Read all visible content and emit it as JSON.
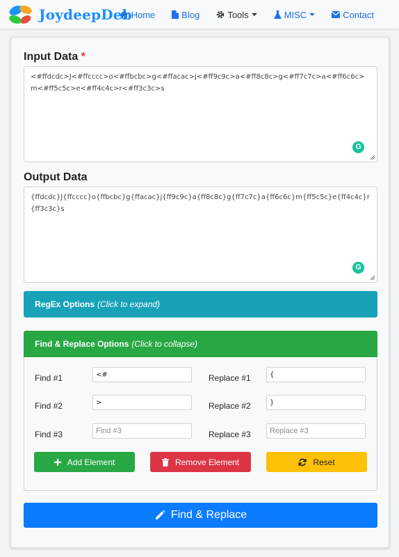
{
  "brand": {
    "name": "JoydeepDeb"
  },
  "nav": {
    "home": "Home",
    "blog": "Blog",
    "tools": "Tools",
    "misc": "MISC",
    "contact": "Contact"
  },
  "input": {
    "label": "Input Data",
    "required_mark": "*",
    "value": "<#ffdcdc>J<#ffcccc>o<#ffbcbc>g<#ffacac>j<#ff9c9c>a<#ff8c8c>g<#ff7c7c>a<#ff6c6c>m<#ff5c5c>e<#ff4c4c>r<#ff3c3c>s"
  },
  "output": {
    "label": "Output Data",
    "value": "{ffdcdc}J{ffcccc}o{ffbcbc}g{ffacac}j{ff9c9c}a{ff8c8c}g{ff7c7c}a{ff6c6c}m{ff5c5c}e{ff4c4c}r{ff3c3c}s"
  },
  "grammarly_icon": "G",
  "regex": {
    "title": "RegEx Options",
    "hint": "(Click to expand)"
  },
  "find_replace": {
    "title": "Find & Replace Options",
    "hint": "(Click to collapse)",
    "rows": [
      {
        "find_label": "Find #1",
        "find_value": "<#",
        "find_placeholder": "Find #1",
        "replace_label": "Replace #1",
        "replace_value": "{",
        "replace_placeholder": "Replace #1"
      },
      {
        "find_label": "Find #2",
        "find_value": ">",
        "find_placeholder": "Find #2",
        "replace_label": "Replace #2",
        "replace_value": "}",
        "replace_placeholder": "Replace #2"
      },
      {
        "find_label": "Find #3",
        "find_value": "",
        "find_placeholder": "Find #3",
        "replace_label": "Replace #3",
        "replace_value": "",
        "replace_placeholder": "Replace #3"
      }
    ],
    "add_label": "Add Element",
    "remove_label": "Remove Element",
    "reset_label": "Reset"
  },
  "action": {
    "label": "Find & Replace"
  },
  "colors": {
    "accent": "#0b7bff",
    "teal": "#17a2b8",
    "green": "#28a745",
    "red": "#dc3545",
    "yellow": "#ffc107"
  }
}
